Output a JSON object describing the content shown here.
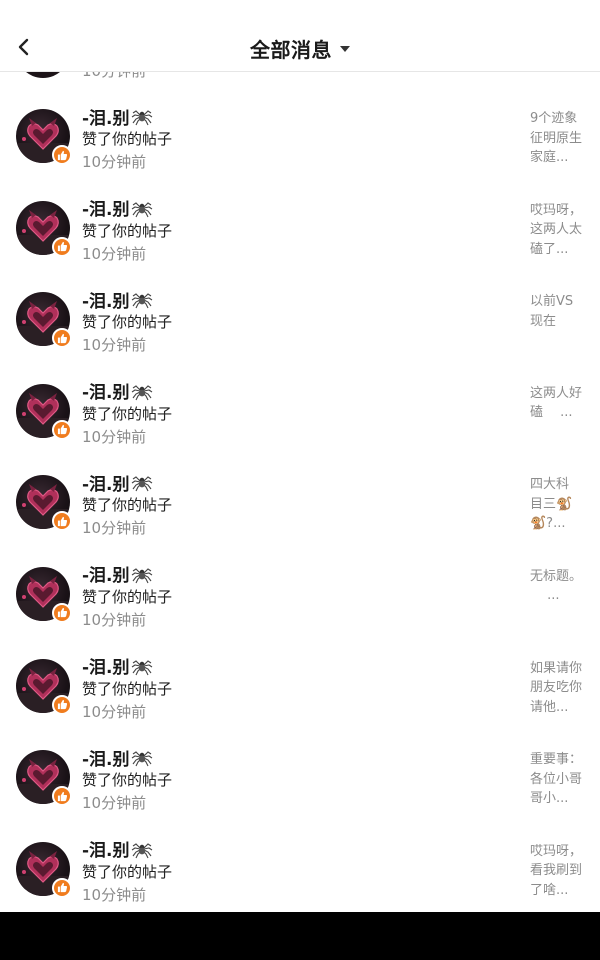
{
  "header": {
    "title": "全部消息"
  },
  "partial_row": {
    "time": "10分钟前"
  },
  "notifications": [
    {
      "name": "-泪.别",
      "action": "赞了你的帖子",
      "time": "10分钟前",
      "snippet": "9个迹象\n征明原生\n家庭..."
    },
    {
      "name": "-泪.别",
      "action": "赞了你的帖子",
      "time": "10分钟前",
      "snippet": "哎玛呀，\n这两人太\n磕了..."
    },
    {
      "name": "-泪.别",
      "action": "赞了你的帖子",
      "time": "10分钟前",
      "snippet": "以前VS\n现在"
    },
    {
      "name": "-泪.别",
      "action": "赞了你的帖子",
      "time": "10分钟前",
      "snippet": "这两人好\n磕　 ..."
    },
    {
      "name": "-泪.别",
      "action": "赞了你的帖子",
      "time": "10分钟前",
      "snippet": "四大科\n目三🐒\n🐒?..."
    },
    {
      "name": "-泪.别",
      "action": "赞了你的帖子",
      "time": "10分钟前",
      "snippet": "无标题。\n　 ..."
    },
    {
      "name": "-泪.别",
      "action": "赞了你的帖子",
      "time": "10分钟前",
      "snippet": "如果请你\n朋友吃你\n请他..."
    },
    {
      "name": "-泪.别",
      "action": "赞了你的帖子",
      "time": "10分钟前",
      "snippet": "重要事：\n各位小哥\n哥小..."
    },
    {
      "name": "-泪.别",
      "action": "赞了你的帖子",
      "time": "10分钟前",
      "snippet": "哎玛呀，\n看我刷到\n了啥..."
    }
  ],
  "icons": {
    "back": "chevron-left-icon",
    "dropdown": "caret-down-icon",
    "badge": "thumbs-up-icon",
    "name_decoration": "spider-icon"
  },
  "colors": {
    "accent_badge": "#f07c1e",
    "time_text": "#8c8c8c",
    "snippet_text": "#8c8c8c",
    "avatar_heart": "#b0305a"
  }
}
